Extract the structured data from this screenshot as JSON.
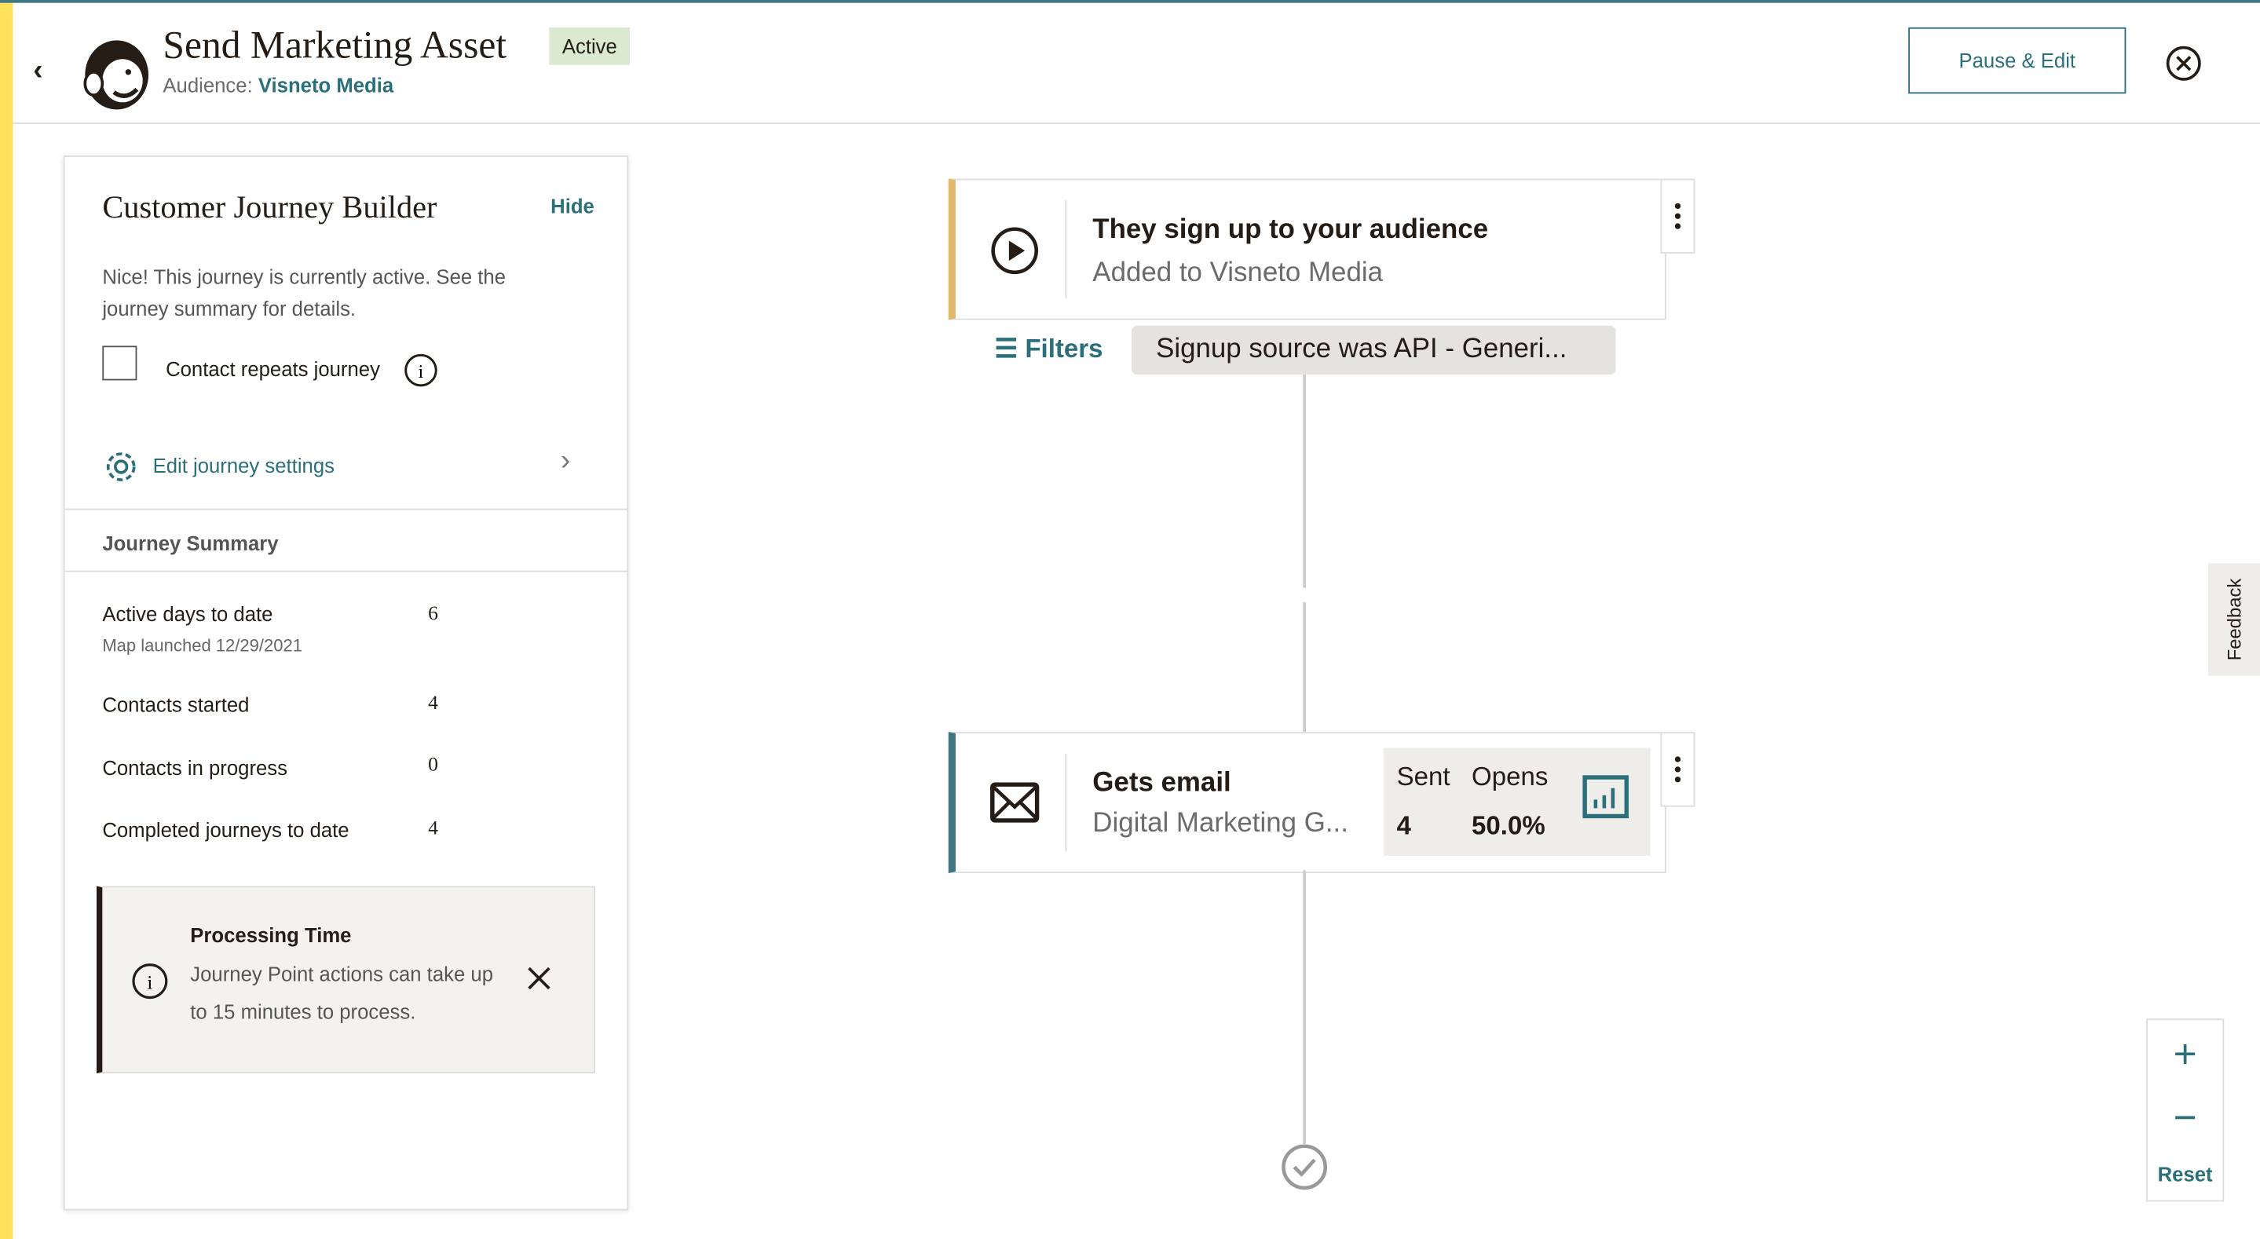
{
  "header": {
    "title": "Send Marketing Asset",
    "status": "Active",
    "audience_label": "Audience:",
    "audience_name": "Visneto Media",
    "pause_edit": "Pause & Edit"
  },
  "panel": {
    "title": "Customer Journey Builder",
    "hide": "Hide",
    "message": "Nice! This journey is currently active. See the journey summary for details.",
    "repeat_label": "Contact repeats journey",
    "repeat_checked": false,
    "edit_settings": "Edit journey settings",
    "summary_title": "Journey Summary",
    "stats": [
      {
        "label": "Active days to date",
        "sub": "Map launched 12/29/2021",
        "value": "6"
      },
      {
        "label": "Contacts started",
        "value": "4"
      },
      {
        "label": "Contacts in progress",
        "value": "0"
      },
      {
        "label": "Completed journeys to date",
        "value": "4"
      }
    ],
    "notice": {
      "title": "Processing Time",
      "body": "Journey Point actions can take up to 15 minutes to process."
    }
  },
  "canvas": {
    "trigger": {
      "title": "They sign up to your audience",
      "subtitle": "Added to Visneto Media"
    },
    "filters": {
      "label": "Filters",
      "chip": "Signup source was API - Generi..."
    },
    "email": {
      "title": "Gets email",
      "subtitle": "Digital Marketing G...",
      "sent_label": "Sent",
      "sent_value": "4",
      "opens_label": "Opens",
      "opens_value": "50.0%"
    },
    "feedback": "Feedback",
    "zoom": {
      "reset": "Reset"
    }
  },
  "colors": {
    "accent": "#2b6f7a",
    "trigger_bar": "#e0b96b",
    "email_bar": "#3f7880",
    "sidebar": "#ffe15a",
    "badge": "#dbe9d1"
  }
}
